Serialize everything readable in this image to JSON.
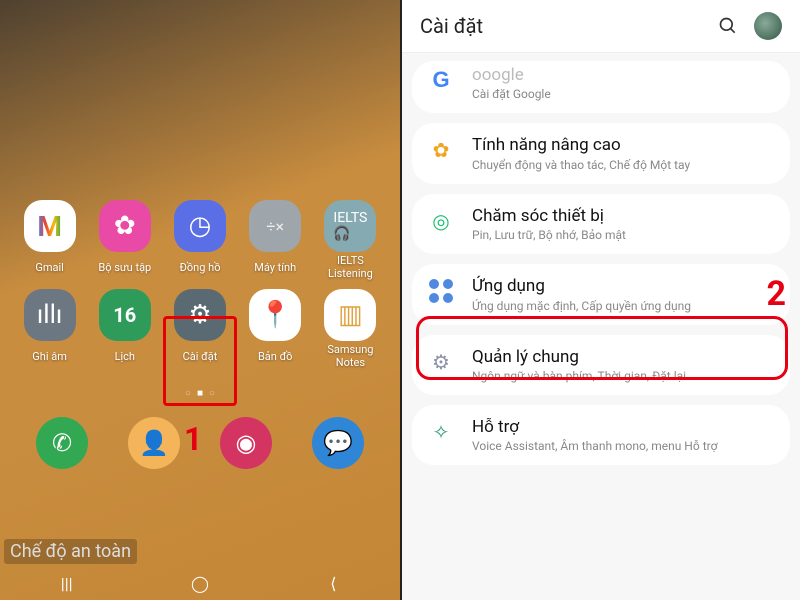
{
  "home": {
    "apps_row1": [
      {
        "label": "Gmail",
        "icon": "M",
        "tile": "white",
        "name": "app-gmail"
      },
      {
        "label": "Bộ sưu tập",
        "icon": "✿",
        "tile": "pink",
        "name": "app-gallery"
      },
      {
        "label": "Đồng hồ",
        "icon": "◷",
        "tile": "blue",
        "name": "app-clock"
      },
      {
        "label": "Máy tính",
        "icon": "÷×",
        "tile": "grey",
        "name": "app-calculator"
      },
      {
        "label": "IELTS Listening",
        "icon": "🎧",
        "tile": "teal",
        "name": "app-ielts-listening"
      }
    ],
    "apps_row2": [
      {
        "label": "Ghi âm",
        "icon": "ıllı",
        "tile": "dark",
        "name": "app-voice-recorder"
      },
      {
        "label": "Lịch",
        "icon": "16",
        "tile": "green",
        "name": "app-calendar"
      },
      {
        "label": "Cài đặt",
        "icon": "⚙",
        "tile": "slate",
        "name": "app-settings"
      },
      {
        "label": "Bản đồ",
        "icon": "📍",
        "tile": "white",
        "name": "app-maps"
      },
      {
        "label": "Samsung Notes",
        "icon": "📓",
        "tile": "white",
        "name": "app-samsung-notes"
      }
    ],
    "safe_mode": "Chế độ an toàn",
    "page_indicator": "○ ■ ○",
    "annotation_1": "1"
  },
  "settings": {
    "title": "Cài đặt",
    "items": [
      {
        "title": "Google",
        "sub": "Cài đặt Google",
        "iconKey": "g",
        "name": "set-google",
        "clipped": true
      },
      {
        "title": "Tính năng nâng cao",
        "sub": "Chuyển động và thao tác, Chế độ Một tay",
        "iconKey": "flower",
        "name": "set-advanced-features"
      },
      {
        "title": "Chăm sóc thiết bị",
        "sub": "Pin, Lưu trữ, Bộ nhớ, Bảo mật",
        "iconKey": "care",
        "name": "set-device-care"
      },
      {
        "title": "Ứng dụng",
        "sub": "Ứng dụng mặc định, Cấp quyền ứng dụng",
        "iconKey": "apps",
        "name": "set-apps"
      },
      {
        "title": "Quản lý chung",
        "sub": "Ngôn ngữ và bàn phím, Thời gian, Đặt lại",
        "iconKey": "sliders",
        "name": "set-general-management"
      },
      {
        "title": "Hỗ trợ",
        "sub": "Voice Assistant, Âm thanh mono, menu Hỗ trợ",
        "iconKey": "support",
        "name": "set-accessibility"
      }
    ],
    "annotation_2": "2"
  }
}
